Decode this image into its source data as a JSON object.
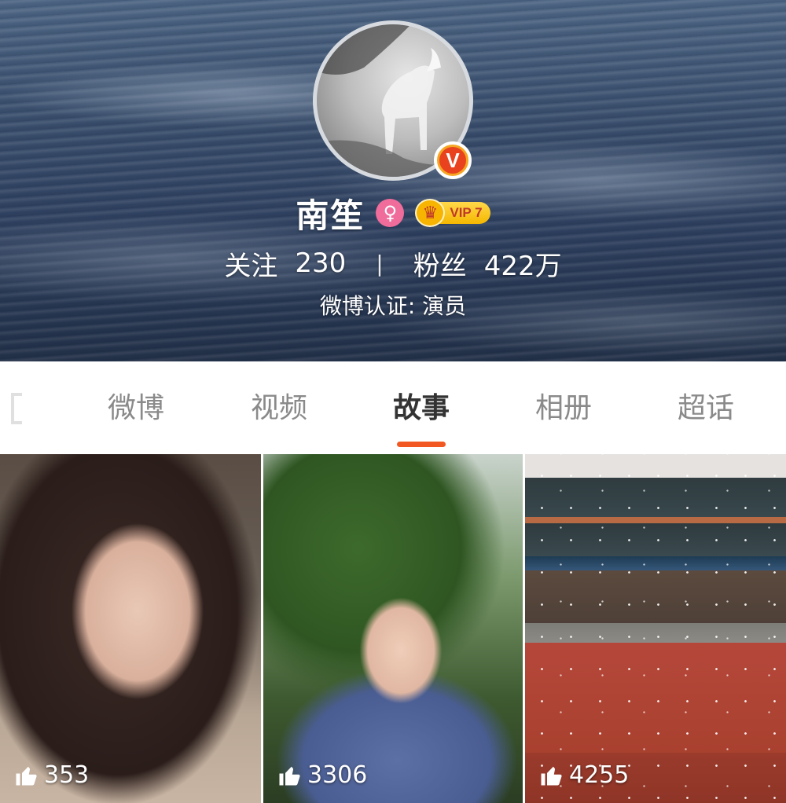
{
  "profile": {
    "name": "南笙",
    "vip_label": "VIP 7",
    "verified_badge": "V",
    "gender_icon": "female-icon",
    "stats": {
      "following_label": "关注",
      "following_count": "230",
      "separator": "|",
      "followers_label": "粉丝",
      "followers_count": "422万"
    },
    "verification": "微博认证: 演员"
  },
  "tabs": [
    {
      "label": "微博",
      "active": false
    },
    {
      "label": "视频",
      "active": false
    },
    {
      "label": "故事",
      "active": true
    },
    {
      "label": "相册",
      "active": false
    },
    {
      "label": "超话",
      "active": false
    }
  ],
  "stories": [
    {
      "likes": "353",
      "icon": "thumbs-up-icon"
    },
    {
      "likes": "3306",
      "icon": "thumbs-up-icon"
    },
    {
      "likes": "4255",
      "icon": "thumbs-up-icon"
    }
  ],
  "colors": {
    "accent": "#f25822",
    "active_tab_text": "#333333",
    "inactive_tab_text": "#8a8a8a",
    "verified_badge": "#e8431e",
    "vip_gold": "#f5b700",
    "gender_pink": "#f06c9b"
  }
}
